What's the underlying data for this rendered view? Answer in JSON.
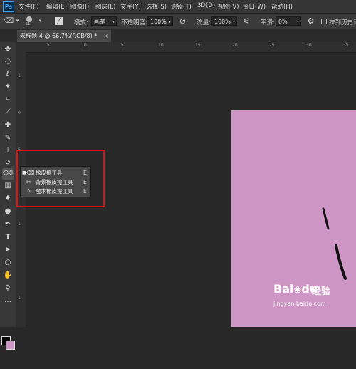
{
  "menubar": {
    "logo": "Ps",
    "items": [
      "文件(F)",
      "编辑(E)",
      "图像(I)",
      "图层(L)",
      "文字(Y)",
      "选择(S)",
      "滤镜(T)",
      "3D(D)",
      "视图(V)",
      "窗口(W)",
      "帮助(H)"
    ]
  },
  "options": {
    "brush_size": "51",
    "mode_label": "模式:",
    "mode_value": "画笔",
    "opacity_label": "不透明度:",
    "opacity_value": "100%",
    "flow_label": "流量:",
    "flow_value": "100%",
    "smooth_label": "平滑:",
    "smooth_value": "0%",
    "erase_history_label": "抹到历史记"
  },
  "tab": {
    "title": "未标题-4 @ 66.7%(RGB/8) *",
    "close": "×"
  },
  "ruler": {
    "h_ticks": [
      "5",
      "0",
      "5",
      "10",
      "15",
      "20",
      "25",
      "30",
      "35"
    ],
    "v_ticks": [
      "1",
      "0",
      "5",
      "1",
      "1"
    ]
  },
  "flyout": {
    "items": [
      {
        "mark": "■",
        "label": "橡皮擦工具",
        "key": "E"
      },
      {
        "mark": "",
        "label": "背景橡皮擦工具",
        "key": "E"
      },
      {
        "mark": "",
        "label": "魔术橡皮擦工具",
        "key": "E"
      }
    ]
  },
  "watermark": {
    "baidu": "Bai",
    "baidu2": "du",
    "jingyan": "经验",
    "url": "jingyan.baidu.com"
  },
  "colors": {
    "document": "#cd96c4",
    "highlight": "#e01010",
    "app_bg": "#282828"
  }
}
